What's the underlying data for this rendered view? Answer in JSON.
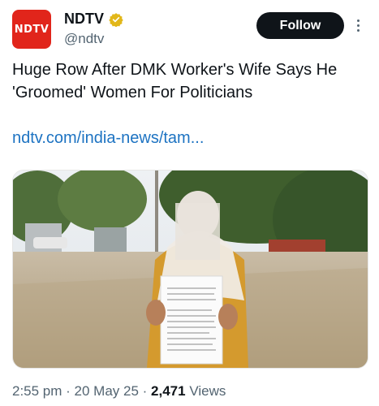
{
  "account": {
    "logo_text": "NDTV",
    "name": "NDTV",
    "handle": "@ndtv",
    "verified_badge": "gold-check-badge",
    "brand_color": "#e1251b"
  },
  "follow_label": "Follow",
  "more_icon": "more-vertical-icon",
  "tweet": {
    "text": "Huge Row After DMK Worker's Wife Says He 'Groomed' Women For Politicians",
    "link": "ndtv.com/india-news/tam...",
    "link_color": "#1d73c2"
  },
  "media": {
    "description_icon": "video-photo-thumbnail"
  },
  "meta": {
    "time": "2:55 pm",
    "sep1": " · ",
    "date": "20 May 25",
    "sep2": " · ",
    "views_count": "2,471",
    "views_label": " Views"
  }
}
